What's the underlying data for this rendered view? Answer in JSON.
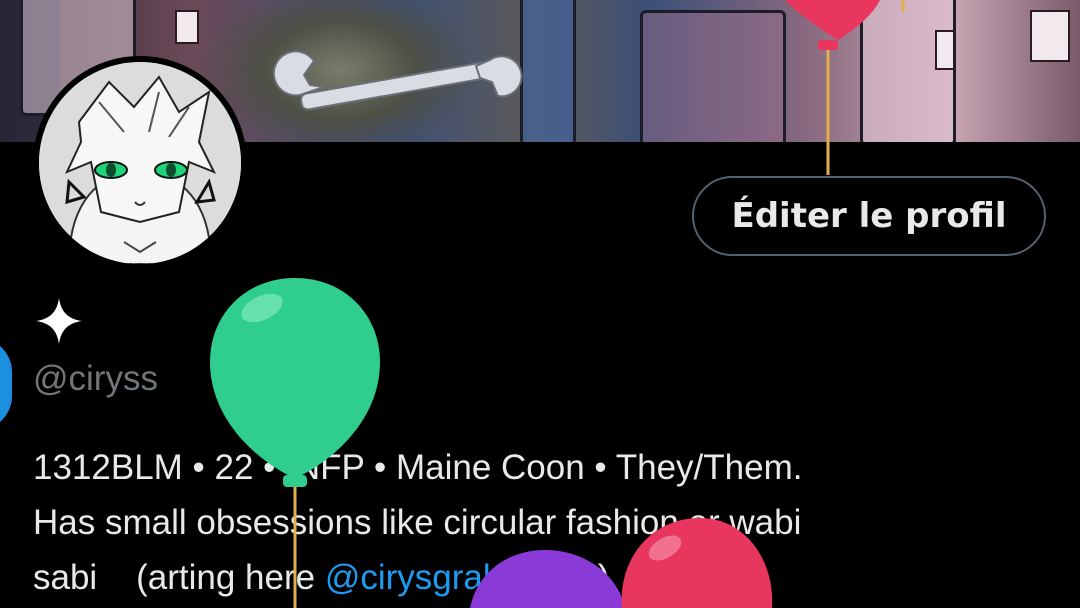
{
  "profile": {
    "handle": "@ciryss",
    "edit_button_label": "Éditer le profil",
    "bio": {
      "line1": "1312BLM • 22 • INFP • Maine Coon • They/Them.",
      "line2": "Has small obsessions like circular fashion or wabi",
      "line3_prefix": "sabi    (arting here ",
      "line3_mention": "@cirysgrabsapen",
      "line3_suffix": ")"
    }
  },
  "icons": {
    "name_badge": "sparkle-icon"
  },
  "colors": {
    "background": "#000000",
    "text_primary": "#e7e9ea",
    "text_secondary": "#71767b",
    "link": "#1d9bf0",
    "button_border": "#536471",
    "balloon_green": "#2fce8f",
    "balloon_red": "#e8365e",
    "balloon_purple": "#8a3ad6"
  }
}
